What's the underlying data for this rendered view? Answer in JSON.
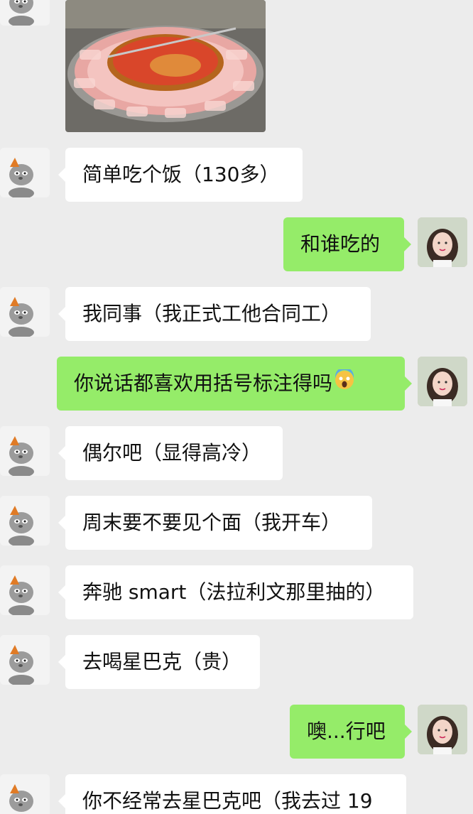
{
  "messages": [
    {
      "side": "left",
      "type": "image",
      "image_desc": "hotpot-with-sliced-meat"
    },
    {
      "side": "left",
      "type": "text",
      "text": "简单吃个饭（130多）"
    },
    {
      "side": "right",
      "type": "text",
      "text": "和谁吃的"
    },
    {
      "side": "left",
      "type": "text",
      "text": "我同事（我正式工他合同工）"
    },
    {
      "side": "right",
      "type": "text",
      "text": "你说话都喜欢用括号标注得吗",
      "emoji": "screaming-face-emoji"
    },
    {
      "side": "left",
      "type": "text",
      "text": "偶尔吧（显得高冷）"
    },
    {
      "side": "left",
      "type": "text",
      "text": "周末要不要见个面（我开车）"
    },
    {
      "side": "left",
      "type": "text",
      "text": "奔驰 smart（法拉利文那里抽的）"
    },
    {
      "side": "left",
      "type": "text",
      "text": "去喝星巴克（贵）"
    },
    {
      "side": "right",
      "type": "text",
      "text": "噢...行吧"
    },
    {
      "side": "left",
      "type": "text",
      "text": "你不经常去星巴克吧（我去过 19"
    }
  ],
  "colors": {
    "background": "#ececec",
    "bubble_left": "#ffffff",
    "bubble_right": "#95ec69",
    "text": "#111111"
  },
  "icons": {
    "left_avatar": "cartoon-cat-avatar",
    "right_avatar": "girl-portrait-avatar"
  }
}
